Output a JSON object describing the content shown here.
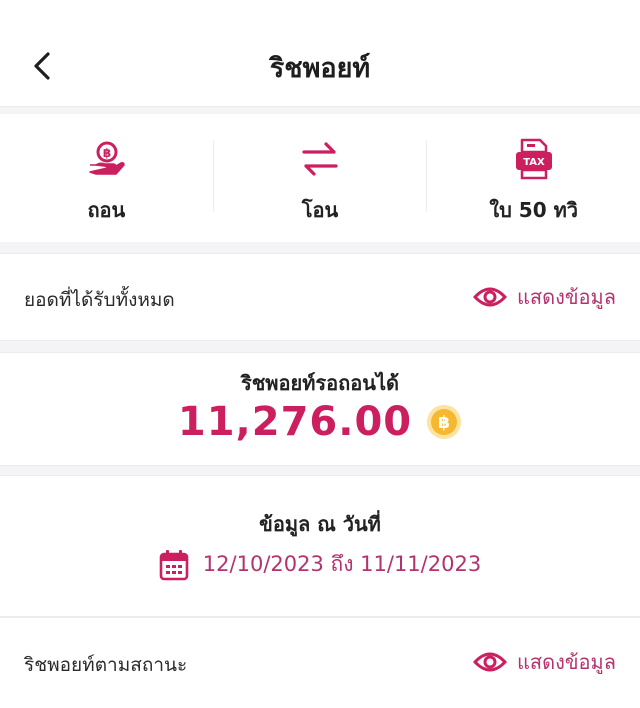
{
  "header": {
    "title": "ริชพอยท์"
  },
  "actions": [
    {
      "label": "ถอน",
      "icon": "coin-hand-icon"
    },
    {
      "label": "โอน",
      "icon": "transfer-arrows-icon"
    },
    {
      "label": "ใบ 50 ทวิ",
      "icon": "tax-document-icon"
    }
  ],
  "total_received": {
    "label": "ยอดที่ได้รับทั้งหมด",
    "show_label": "แสดงข้อมูล"
  },
  "pending": {
    "title": "ริชพอยท์รอถอนได้",
    "amount": "11,276.00"
  },
  "date_info": {
    "title": "ข้อมูล ณ วันที่",
    "range": "12/10/2023 ถึง 11/11/2023"
  },
  "by_status": {
    "label": "ริชพอยท์ตามสถานะ",
    "show_label": "แสดงข้อมูล"
  },
  "colors": {
    "accent": "#cc1f5f",
    "accent_text": "#b3336e",
    "coin": "#f5b830"
  }
}
